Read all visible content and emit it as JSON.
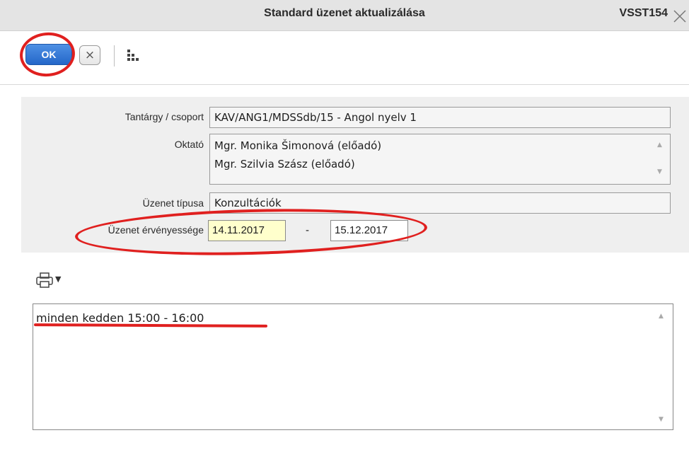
{
  "window": {
    "title": "Standard üzenet aktualizálása",
    "code": "VSST154"
  },
  "toolbar": {
    "ok_label": "OK",
    "cancel_label": "×"
  },
  "form": {
    "subject_group": {
      "label": "Tantárgy / csoport",
      "value": "KAV/ANG1/MDSSdb/15 - Angol nyelv 1"
    },
    "teacher": {
      "label": "Oktató",
      "values": [
        "Mgr. Monika Šimonová (előadó)",
        "Mgr. Szilvia Szász (előadó)"
      ]
    },
    "message_type": {
      "label": "Üzenet típusa",
      "value": "Konzultációk"
    },
    "validity": {
      "label": "Üzenet érvényessége",
      "from": "14.11.2017",
      "separator": "-",
      "to": "15.12.2017"
    }
  },
  "editor": {
    "text": "minden kedden 15:00 - 16:00"
  },
  "colors": {
    "annotation_red": "#e0201f",
    "ok_blue": "#2f74d4",
    "date_from_bg": "#ffffcc",
    "form_bg": "#efefef"
  },
  "icons": [
    "close-icon",
    "cancel-icon",
    "org-chart-icon",
    "print-icon",
    "dropdown-caret-icon",
    "scroll-up-icon",
    "scroll-down-icon"
  ]
}
